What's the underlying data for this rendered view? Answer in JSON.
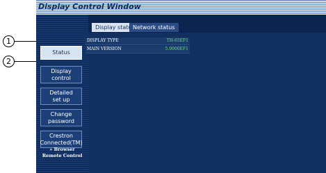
{
  "window": {
    "title": "Display Control Window"
  },
  "sidebar": {
    "items": [
      {
        "label": "Status",
        "active": true
      },
      {
        "label": "Display\ncontrol",
        "active": false
      },
      {
        "label": "Detailed\nset up",
        "active": false
      },
      {
        "label": "Change\npassword",
        "active": false
      },
      {
        "label": "Crestron\nConnected(TM)",
        "active": false
      }
    ],
    "browser_link": "» Browser\nRemote Control"
  },
  "tabs": [
    {
      "label": "Display status",
      "active": true
    },
    {
      "label": "Network status",
      "active": false
    }
  ],
  "status_rows": [
    {
      "key": "DISPLAY TYPE",
      "value": "TH-65EF1"
    },
    {
      "key": "MAIN VERSION",
      "value": "5.0000EF1"
    }
  ],
  "callouts": [
    "1",
    "2"
  ],
  "colors": {
    "value_text": "#67e07a",
    "window_bg": "#0e2a57",
    "active_item": "#d9e4f2"
  }
}
